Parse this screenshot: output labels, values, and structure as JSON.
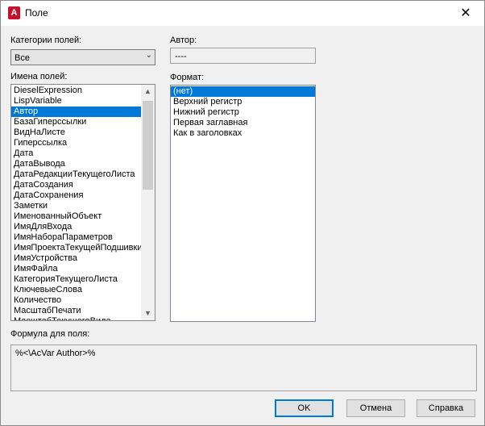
{
  "window": {
    "title": "Поле",
    "icon_letter": "A",
    "close_glyph": "✕"
  },
  "categories": {
    "label": "Категории полей:",
    "selected": "Все"
  },
  "author": {
    "label": "Автор:",
    "value": "----"
  },
  "field_names": {
    "label": "Имена полей:",
    "items": [
      "DieselExpression",
      "LispVariable",
      "Автор",
      "БазаГиперссылки",
      "ВидНаЛисте",
      "Гиперссылка",
      "Дата",
      "ДатаВывода",
      "ДатаРедакцииТекущегоЛиста",
      "ДатаСоздания",
      "ДатаСохранения",
      "Заметки",
      "ИменованныйОбъект",
      "ИмяДляВхода",
      "ИмяНабораПараметров",
      "ИмяПроектаТекущейПодшивки",
      "ИмяУстройства",
      "ИмяФайла",
      "КатегорияТекущегоЛиста",
      "КлючевыеСлова",
      "Количество",
      "МасштабПечати",
      "МасштабТекущегоВида"
    ],
    "selected_index": 2
  },
  "format": {
    "label": "Формат:",
    "items": [
      "(нет)",
      "Верхний регистр",
      "Нижний регистр",
      "Первая заглавная",
      "Как в заголовках"
    ],
    "selected_index": 0
  },
  "formula": {
    "label": "Формула для поля:",
    "value": "%<\\AcVar Author>%"
  },
  "buttons": {
    "ok": "OK",
    "cancel": "Отмена",
    "help": "Справка"
  },
  "colors": {
    "selection": "#0078d7",
    "app_icon": "#c8102e"
  }
}
